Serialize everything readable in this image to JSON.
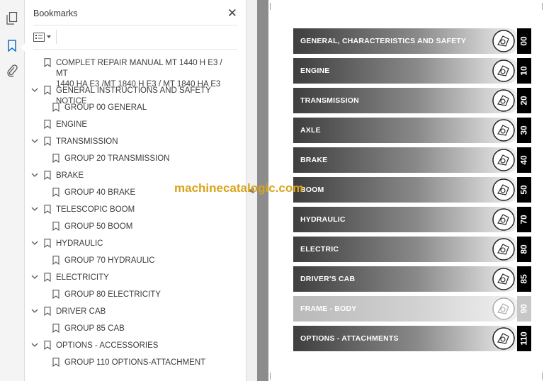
{
  "sidebar": {
    "tools": [
      {
        "icon": "page-thumbnails-icon"
      },
      {
        "icon": "bookmark-icon"
      },
      {
        "icon": "paperclip-icon"
      }
    ]
  },
  "bookmarks_panel": {
    "title": "Bookmarks",
    "close_label": "✕",
    "items": [
      {
        "label": "COMPLET REPAIR MANUAL  MT 1440 H E3 / MT 1440 HA E3 /MT 1840 H E3 / MT 1840 HA E3",
        "label_line1": "COMPLET REPAIR MANUAL  MT 1440 H E3 / MT",
        "label_line2": "1440 HA E3 /MT 1840 H E3 / MT 1840 HA E3",
        "level": 0,
        "expandable": false
      },
      {
        "label": "GENERAL INSTRUCTIONS AND SAFETY NOTICE",
        "level": 0,
        "expandable": true
      },
      {
        "label": "GROUP 00 GENERAL",
        "level": 1,
        "expandable": false
      },
      {
        "label": "ENGINE",
        "level": 0,
        "expandable": false
      },
      {
        "label": "TRANSMISSION",
        "level": 0,
        "expandable": true
      },
      {
        "label": "GROUP 20 TRANSMISSION",
        "level": 1,
        "expandable": false
      },
      {
        "label": "BRAKE",
        "level": 0,
        "expandable": true
      },
      {
        "label": "GROUP 40 BRAKE",
        "level": 1,
        "expandable": false
      },
      {
        "label": "TELESCOPIC BOOM",
        "level": 0,
        "expandable": true
      },
      {
        "label": "GROUP 50 BOOM",
        "level": 1,
        "expandable": false
      },
      {
        "label": "HYDRAULIC",
        "level": 0,
        "expandable": true
      },
      {
        "label": "GROUP 70 HYDRAULIC",
        "level": 1,
        "expandable": false
      },
      {
        "label": "ELECTRICITY",
        "level": 0,
        "expandable": true
      },
      {
        "label": "GROUP 80 ELECTRICITY",
        "level": 1,
        "expandable": false
      },
      {
        "label": "DRIVER CAB",
        "level": 0,
        "expandable": true
      },
      {
        "label": "GROUP 85 CAB",
        "level": 1,
        "expandable": false
      },
      {
        "label": "OPTIONS - ACCESSORIES",
        "level": 0,
        "expandable": true
      },
      {
        "label": "GROUP 110 OPTIONS-ATTACHMENT",
        "level": 1,
        "expandable": false
      }
    ]
  },
  "watermark": "machinecatalogic.com",
  "document_page": {
    "sections": [
      {
        "label": "GENERAL, CHARACTERISTICS AND SAFETY",
        "number": "00",
        "icon": "tools-icon",
        "dimmed": false
      },
      {
        "label": "ENGINE",
        "number": "10",
        "icon": "engine-icon",
        "dimmed": false
      },
      {
        "label": "TRANSMISSION",
        "number": "20",
        "icon": "transmission-icon",
        "dimmed": false
      },
      {
        "label": "AXLE",
        "number": "30",
        "icon": "axle-icon",
        "dimmed": false
      },
      {
        "label": "BRAKE",
        "number": "40",
        "icon": "brake-icon",
        "dimmed": false
      },
      {
        "label": "BOOM",
        "number": "50",
        "icon": "boom-icon",
        "dimmed": false
      },
      {
        "label": "HYDRAULIC",
        "number": "70",
        "icon": "hydraulic-icon",
        "dimmed": false
      },
      {
        "label": "ELECTRIC",
        "number": "80",
        "icon": "electric-icon",
        "dimmed": false
      },
      {
        "label": "DRIVER'S CAB",
        "number": "85",
        "icon": "cab-icon",
        "dimmed": false
      },
      {
        "label": "FRAME - BODY",
        "number": "90",
        "icon": "frame-icon",
        "dimmed": true
      },
      {
        "label": "OPTIONS - ATTACHMENTS",
        "number": "110",
        "icon": "attachments-icon",
        "dimmed": false
      }
    ]
  },
  "colors": {
    "watermark": "#d9a419",
    "band_dark": "#3e3e3e",
    "band_dim": "#b9b9b9",
    "accent": "#1a73c9"
  }
}
